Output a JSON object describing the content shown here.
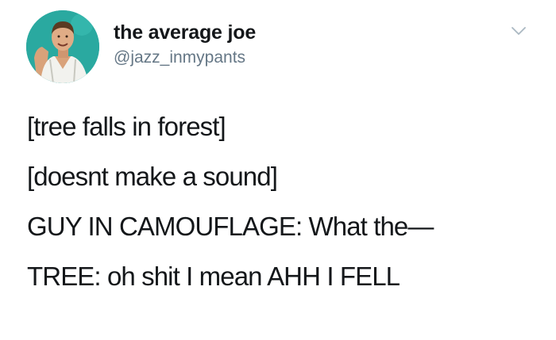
{
  "user": {
    "display_name": "the average joe",
    "handle": "@jazz_inmypants"
  },
  "icons": {
    "avatar": "avatar-photo",
    "menu": "chevron-down-icon"
  },
  "tweet": {
    "lines": [
      "[tree falls in forest]",
      "[doesnt make a sound]",
      "GUY IN CAMOUFLAGE: What the—",
      "TREE: oh shit I mean AHH I FELL"
    ]
  },
  "colors": {
    "avatar_bg": "#2aa9a0",
    "text": "#14171a",
    "secondary_text": "#657786"
  }
}
